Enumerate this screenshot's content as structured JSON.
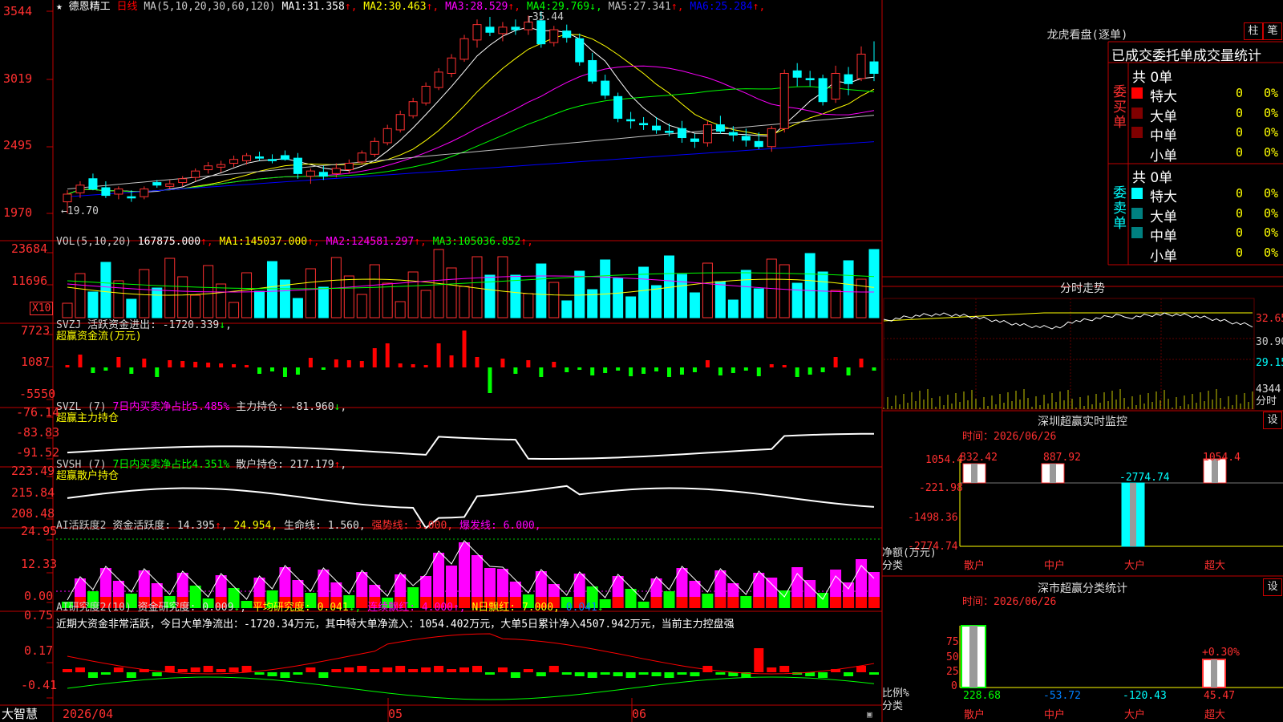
{
  "header": {
    "star": "★",
    "stock_name": "德恩精工",
    "period": "日线",
    "ma_label": "MA(5,10,20,30,60,120)",
    "ma": [
      {
        "name": "MA1:",
        "value": "31.358",
        "arrow": "↑",
        "color": "#ffffff"
      },
      {
        "name": "MA2:",
        "value": "30.463",
        "arrow": "↑",
        "color": "#ffff00"
      },
      {
        "name": "MA3:",
        "value": "28.529",
        "arrow": "↑",
        "color": "#ff00ff"
      },
      {
        "name": "MA4:",
        "value": "29.769",
        "arrow": "↓",
        "color": "#00ff00"
      },
      {
        "name": "MA5:",
        "value": "27.341",
        "arrow": "↑",
        "color": "#c0c0c0"
      },
      {
        "name": "MA6:",
        "value": "25.284",
        "arrow": "↑",
        "color": "#0000ff"
      }
    ],
    "high_mark": "35.44",
    "low_mark": "19.70"
  },
  "price_axis": [
    "3544",
    "3019",
    "2495",
    "1970"
  ],
  "vol": {
    "label": "VOL(5,10,20)",
    "value": "167875.000",
    "ma": [
      {
        "name": "MA1:",
        "value": "145037.000",
        "arrow": "↑",
        "color": "#ffff00"
      },
      {
        "name": "MA2:",
        "value": "124581.297",
        "arrow": "↑",
        "color": "#ff00ff"
      },
      {
        "name": "MA3:",
        "value": "105036.852",
        "arrow": "↑",
        "color": "#00ff00"
      }
    ],
    "axis": [
      "23684",
      "11696"
    ],
    "unit": "X10"
  },
  "svzj": {
    "label": "SVZJ",
    "desc": "活跃资金进出:",
    "value": "-1720.339",
    "arrow": "↓",
    "subtitle": "超赢资金流(万元)",
    "axis": [
      "7723",
      "1087",
      "-5550"
    ]
  },
  "svzl": {
    "label": "SVZL (7)",
    "desc": "7日内买卖净占比5.485%",
    "hold": "主力持仓:",
    "value": "-81.960",
    "arrow": "↓",
    "subtitle": "超赢主力持仓",
    "axis": [
      "-76.14",
      "-83.83",
      "-91.52"
    ]
  },
  "svsh": {
    "label": "SVSH (7)",
    "desc": "7日内买卖净占比4.351%",
    "hold": "散户持仓:",
    "value": "217.179",
    "arrow": "↑",
    "subtitle": "超赢散户持仓",
    "axis": [
      "223.49",
      "215.84",
      "208.48"
    ]
  },
  "ai_active": {
    "label": "AI活跃度2",
    "desc": "资金活跃度:",
    "value": "14.395",
    "arrow": "↑",
    "value2": "24.954",
    "life_label": "生命线:",
    "life_value": "1.560",
    "strong_label": "强势线:",
    "strong_value": "3.000",
    "burst_label": "爆发线:",
    "burst_value": "6.000",
    "axis": [
      "24.95",
      "12.33",
      "0.00"
    ]
  },
  "ai_research": {
    "label": "AI研究度2(10)",
    "desc": "资金研究度:",
    "value": "0.009",
    "arrow": "↓",
    "avg_label": "平均研究度:",
    "avg_value": "0.041",
    "streak_label": "连续飘红:",
    "streak_value": "4.000",
    "n_label": "N日飘红:",
    "n_value": "7.000",
    "n2_value": "0.041",
    "summary": "近期大资金非常活跃，今日大单净流出：-1720.34万元，其中特大单净流入：1054.402万元，大单5日累计净入4507.942万元，当前主力控盘强",
    "axis": [
      "0.75",
      "0.17",
      "-0.41"
    ]
  },
  "date_axis": {
    "d1": "2026/04",
    "d2": "05",
    "d3": "06"
  },
  "footer": {
    "brand": "大智慧"
  },
  "longhu": {
    "title": "龙虎看盘(逐单)",
    "btn1": "柱",
    "btn2": "笔",
    "stat_title": "已成交委托单成交量统计",
    "buy_label": "委买单",
    "sell_label": "委卖单",
    "buy_total": "共 0单",
    "sell_total": "共 0单",
    "buy_rows": [
      {
        "name": "特大",
        "count": "0",
        "pct": "0%",
        "color": "#ff0000"
      },
      {
        "name": "大单",
        "count": "0",
        "pct": "0%",
        "color": "#800000"
      },
      {
        "name": "中单",
        "count": "0",
        "pct": "0%",
        "color": "#800000"
      },
      {
        "name": "小单",
        "count": "0",
        "pct": "0%",
        "color": "#000000"
      }
    ],
    "sell_rows": [
      {
        "name": "特大",
        "count": "0",
        "pct": "0%",
        "color": "#00ffff"
      },
      {
        "name": "大单",
        "count": "0",
        "pct": "0%",
        "color": "#008080"
      },
      {
        "name": "中单",
        "count": "0",
        "pct": "0%",
        "color": "#008080"
      },
      {
        "name": "小单",
        "count": "0",
        "pct": "0%",
        "color": "#000000"
      }
    ]
  },
  "intraday": {
    "title": "分时走势",
    "axis": [
      "32.65",
      "30.90",
      "29.15"
    ],
    "vol_axis": "4344",
    "vol_unit": "分时"
  },
  "sz_monitor": {
    "title": "深圳超赢实时监控",
    "settings": "设",
    "time_label": "时间：",
    "time": "2026/06/26",
    "axis": [
      "1054.4",
      "-221.98",
      "-1498.36",
      "-2774.74"
    ],
    "unit1": "净额(万元)",
    "unit2": "分类",
    "categories": [
      "散户",
      "中户",
      "大户",
      "超大"
    ],
    "values": [
      "832.42",
      "887.92",
      "-2774.74",
      "1054.4"
    ]
  },
  "sz_class": {
    "title": "深市超赢分类统计",
    "settings": "设",
    "time_label": "时间：",
    "time": "2026/06/26",
    "axis": [
      "75",
      "50",
      "25",
      "0"
    ],
    "unit1": "比例%",
    "unit2": "分类",
    "categories": [
      "散户",
      "中户",
      "大户",
      "超大"
    ],
    "values": [
      "228.68",
      "-53.72",
      "-120.43",
      "45.47"
    ],
    "mark": "+0.30%"
  },
  "chart_data": {
    "type": "candlestick",
    "ohlc": [
      [
        20.6,
        21.5,
        19.7,
        21.2
      ],
      [
        21.3,
        22.2,
        20.9,
        21.9
      ],
      [
        22.4,
        22.8,
        21.5,
        21.6
      ],
      [
        21.7,
        22.2,
        20.9,
        21.1
      ],
      [
        21.2,
        21.8,
        20.8,
        21.6
      ],
      [
        21.0,
        21.5,
        20.6,
        20.9
      ],
      [
        21.0,
        21.8,
        20.8,
        21.6
      ],
      [
        22.1,
        22.3,
        21.7,
        21.9
      ],
      [
        21.8,
        22.3,
        21.6,
        22.0
      ],
      [
        22.1,
        22.6,
        21.8,
        22.4
      ],
      [
        22.5,
        23.2,
        22.2,
        23.0
      ],
      [
        23.1,
        23.7,
        22.8,
        23.4
      ],
      [
        23.3,
        23.8,
        22.9,
        23.5
      ],
      [
        23.6,
        24.2,
        23.3,
        23.9
      ],
      [
        23.8,
        24.4,
        23.5,
        24.2
      ],
      [
        24.1,
        24.5,
        23.8,
        24.0
      ],
      [
        23.9,
        24.3,
        23.6,
        23.8
      ],
      [
        24.2,
        24.6,
        23.8,
        23.9
      ],
      [
        24.0,
        24.4,
        22.4,
        22.8
      ],
      [
        22.6,
        23.2,
        22.0,
        23.0
      ],
      [
        22.9,
        23.4,
        22.3,
        22.6
      ],
      [
        22.8,
        23.6,
        22.5,
        23.2
      ],
      [
        23.1,
        23.9,
        22.8,
        23.6
      ],
      [
        23.7,
        24.6,
        23.5,
        24.4
      ],
      [
        24.3,
        25.6,
        24.1,
        25.3
      ],
      [
        25.2,
        26.6,
        25.0,
        26.3
      ],
      [
        26.2,
        27.7,
        26.0,
        27.4
      ],
      [
        27.3,
        28.7,
        27.1,
        28.4
      ],
      [
        28.3,
        29.9,
        28.1,
        29.6
      ],
      [
        29.5,
        31.0,
        29.3,
        30.7
      ],
      [
        30.6,
        32.1,
        30.3,
        31.8
      ],
      [
        31.7,
        33.6,
        31.5,
        33.3
      ],
      [
        33.2,
        34.8,
        32.6,
        34.4
      ],
      [
        34.2,
        35.0,
        33.5,
        33.8
      ],
      [
        33.7,
        34.6,
        33.1,
        34.2
      ],
      [
        34.2,
        34.8,
        33.6,
        34.0
      ],
      [
        34.0,
        35.1,
        33.6,
        34.6
      ],
      [
        34.7,
        35.44,
        32.6,
        32.9
      ],
      [
        33.0,
        34.3,
        32.7,
        34.0
      ],
      [
        33.9,
        34.4,
        33.0,
        33.4
      ],
      [
        33.3,
        33.7,
        31.2,
        31.5
      ],
      [
        31.6,
        32.2,
        29.8,
        30.0
      ],
      [
        30.0,
        30.5,
        28.6,
        28.9
      ],
      [
        28.8,
        29.1,
        26.8,
        27.1
      ],
      [
        27.0,
        27.6,
        26.3,
        26.9
      ],
      [
        26.7,
        27.2,
        26.2,
        26.6
      ],
      [
        26.5,
        27.2,
        25.9,
        26.2
      ],
      [
        26.1,
        26.7,
        25.7,
        26.0
      ],
      [
        26.3,
        26.9,
        25.2,
        25.6
      ],
      [
        25.5,
        25.9,
        24.8,
        25.3
      ],
      [
        25.2,
        26.9,
        24.9,
        26.6
      ],
      [
        26.6,
        27.3,
        25.9,
        26.1
      ],
      [
        26.0,
        26.5,
        25.3,
        25.8
      ],
      [
        25.7,
        26.3,
        24.9,
        25.4
      ],
      [
        25.3,
        26.0,
        24.7,
        24.9
      ],
      [
        24.9,
        26.5,
        24.5,
        26.3
      ],
      [
        26.3,
        30.9,
        26.0,
        30.6
      ],
      [
        30.8,
        31.4,
        29.6,
        30.3
      ],
      [
        30.2,
        30.8,
        29.6,
        30.1
      ],
      [
        30.2,
        30.5,
        28.1,
        28.4
      ],
      [
        28.6,
        31.2,
        28.3,
        30.6
      ],
      [
        30.5,
        31.1,
        28.9,
        29.8
      ],
      [
        30.2,
        32.7,
        30.0,
        32.1
      ],
      [
        31.5,
        33.1,
        30.0,
        30.6
      ]
    ]
  }
}
